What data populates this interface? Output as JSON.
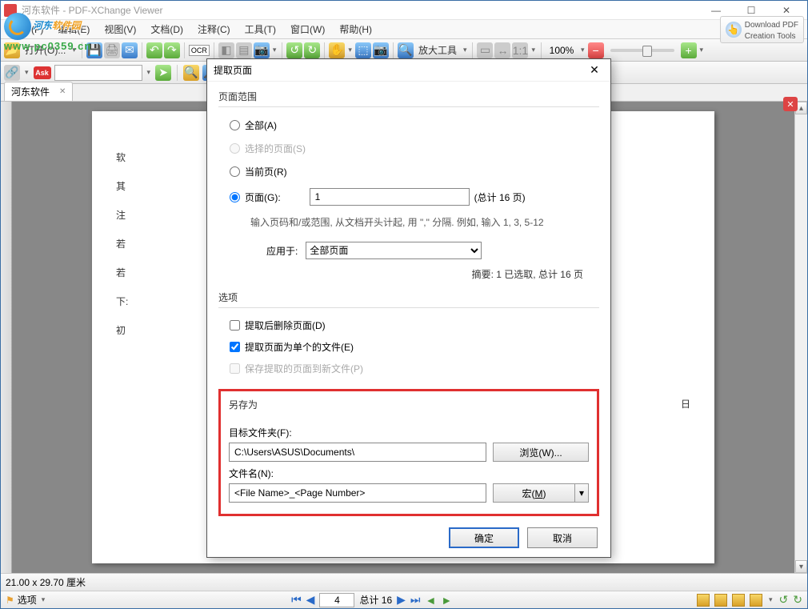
{
  "title": "河东软件 - PDF-XChange Viewer",
  "watermark": {
    "line1a": "河东",
    "line1b": "软件园",
    "url": "www.pc0359.cn"
  },
  "menu": [
    "文件(F)",
    "编辑(E)",
    "视图(V)",
    "文档(D)",
    "注释(C)",
    "工具(T)",
    "窗口(W)",
    "帮助(H)"
  ],
  "download_btn": {
    "l1": "Download PDF",
    "l2": "Creation Tools"
  },
  "toolbar": {
    "open": "打开(O)...",
    "tool": "放大工具",
    "zoom": "100%"
  },
  "tab_name": "河东软件",
  "doc_lines": [
    "软",
    "其",
    "注",
    "若",
    "若",
    "下:",
    "初"
  ],
  "doc_right_char": "日",
  "status": "21.00 x 29.70 厘米",
  "nav": {
    "options": "选项",
    "page": "4",
    "total": "总计 16"
  },
  "dialog": {
    "title": "提取页面",
    "range_legend": "页面范围",
    "r_all": "全部(A)",
    "r_sel": "选择的页面(S)",
    "r_cur": "当前页(R)",
    "r_pages": "页面(G):",
    "pages_value": "1",
    "pages_total": "(总计 16 页)",
    "hint": "输入页码和/或范围, 从文档开头计起, 用 \",\" 分隔. 例如, 输入 1, 3, 5-12",
    "apply_label": "应用于:",
    "apply_value": "全部页面",
    "summary": "摘要: 1 已选取, 总计 16 页",
    "opt_legend": "选项",
    "c_del": "提取后删除页面(D)",
    "c_sep": "提取页面为单个的文件(E)",
    "c_save": "保存提取的页面到新文件(P)",
    "saveas_legend": "另存为",
    "folder_label": "目标文件夹(F):",
    "folder_value": "C:\\Users\\ASUS\\Documents\\",
    "browse": "浏览(W)...",
    "name_label": "文件名(N):",
    "name_value": "<File Name>_<Page Number>",
    "macro": "宏(M)",
    "ok": "确定",
    "cancel": "取消"
  }
}
